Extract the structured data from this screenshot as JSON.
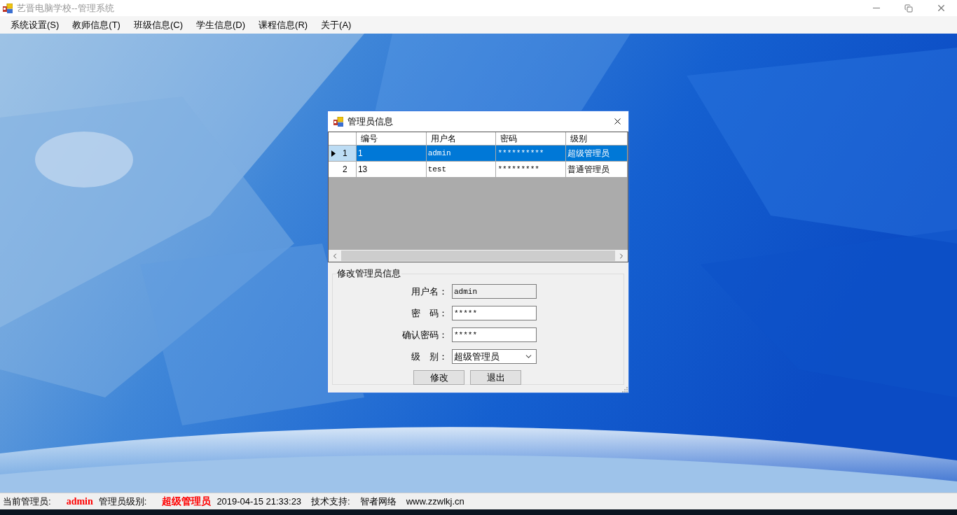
{
  "window": {
    "title": "艺晋电脑学校--管理系统"
  },
  "menu": [
    "系统设置(S)",
    "教师信息(T)",
    "班级信息(C)",
    "学生信息(D)",
    "课程信息(R)",
    "关于(A)"
  ],
  "dialog": {
    "title": "管理员信息",
    "table": {
      "columns": [
        "编号",
        "用户名",
        "密码",
        "级别"
      ],
      "rows": [
        {
          "selected": true,
          "row_number": "1",
          "cells": [
            "1",
            "admin",
            "**********",
            "超级管理员"
          ]
        },
        {
          "selected": false,
          "row_number": "2",
          "cells": [
            "13",
            "test",
            "*********",
            "普通管理员"
          ]
        }
      ]
    },
    "form": {
      "title": "修改管理员信息",
      "fields": [
        {
          "kind": "text",
          "label": "用户名：",
          "value": "admin",
          "disabled": true
        },
        {
          "kind": "text",
          "label": "密　码：",
          "value": "*****",
          "disabled": false
        },
        {
          "kind": "text",
          "label": "确认密码：",
          "value": "*****",
          "disabled": false
        },
        {
          "kind": "select",
          "label": "级　别：",
          "value": "超级管理员",
          "disabled": false
        }
      ],
      "buttons": [
        "修改",
        "退出"
      ]
    }
  },
  "status_bar": [
    {
      "kind": "label",
      "text": "当前管理员:"
    },
    {
      "kind": "value",
      "text": "admin"
    },
    {
      "kind": "label",
      "text": "管理员级别:"
    },
    {
      "kind": "value",
      "text": "超级管理员"
    },
    {
      "kind": "label",
      "text": "2019-04-15 21:33:23"
    },
    {
      "kind": "label",
      "text": "技术支持:"
    },
    {
      "kind": "label",
      "text": "智者网络"
    },
    {
      "kind": "label",
      "text": "www.zzwlkj.cn"
    }
  ]
}
